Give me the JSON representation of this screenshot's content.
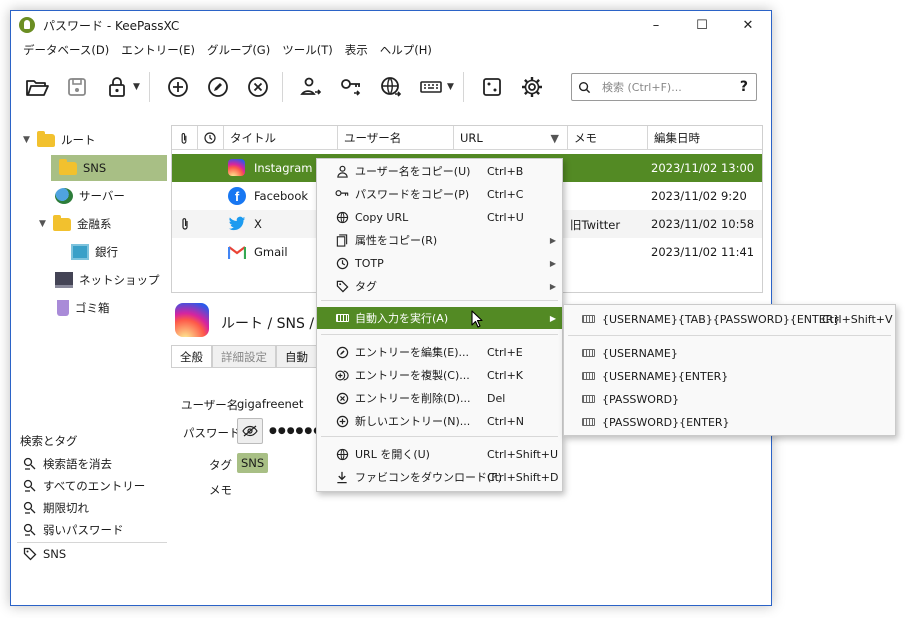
{
  "window": {
    "title": "パスワード - KeePassXC",
    "controls": [
      "–",
      "☐",
      "✕"
    ]
  },
  "menu": [
    "データベース(D)",
    "エントリー(E)",
    "グループ(G)",
    "ツール(T)",
    "表示",
    "ヘルプ(H)"
  ],
  "search": {
    "placeholder": "検索 (Ctrl+F)...",
    "help": "?"
  },
  "groups": [
    {
      "label": "ルート",
      "icon": "folder-icon"
    },
    {
      "label": "SNS",
      "icon": "folder-icon",
      "selected": true
    },
    {
      "label": "サーバー",
      "icon": "globe-icon"
    },
    {
      "label": "金融系",
      "icon": "folder-icon"
    },
    {
      "label": "銀行",
      "icon": "bank-icon"
    },
    {
      "label": "ネットショップ",
      "icon": "monitor-icon"
    },
    {
      "label": "ゴミ箱",
      "icon": "trash-icon"
    }
  ],
  "tags": {
    "header": "検索とタグ",
    "items": [
      "検索語を消去",
      "すべてのエントリー",
      "期限切れ",
      "弱いパスワード"
    ],
    "user_tags": [
      "SNS"
    ]
  },
  "table": {
    "columns": [
      "タイトル",
      "ユーザー名",
      "URL",
      "メモ",
      "編集日時"
    ],
    "rows": [
      {
        "title": "Instagram",
        "note": "",
        "modified": "2023/11/02 13:00",
        "icon": "instagram-icon",
        "selected": true
      },
      {
        "title": "Facebook",
        "note": "",
        "modified": "2023/11/02 9:20",
        "icon": "facebook-icon"
      },
      {
        "title": "X",
        "note": "旧Twitter",
        "modified": "2023/11/02 10:58",
        "icon": "twitter-icon",
        "attachment": true
      },
      {
        "title": "Gmail",
        "note": "",
        "modified": "2023/11/02 11:41",
        "icon": "gmail-icon"
      }
    ]
  },
  "details": {
    "breadcrumb": "ルート / SNS / In",
    "tabs": [
      "全般",
      "詳細設定",
      "自動"
    ],
    "username_label": "ユーザー名",
    "username_value": "gigafreenet",
    "password_label": "パスワード",
    "password_value": "●●●●●●",
    "tags_label": "タグ",
    "tags_value": "SNS",
    "notes_label": "メモ"
  },
  "context_menu": {
    "items": [
      {
        "label": "ユーザー名をコピー(U)",
        "shortcut": "Ctrl+B",
        "icon": "user-icon"
      },
      {
        "label": "パスワードをコピー(P)",
        "shortcut": "Ctrl+C",
        "icon": "key-icon"
      },
      {
        "label": "Copy URL",
        "shortcut": "Ctrl+U",
        "icon": "link-icon"
      },
      {
        "label": "属性をコピー(R)",
        "shortcut": "",
        "icon": "copy-icon",
        "submenu": true
      },
      {
        "label": "TOTP",
        "shortcut": "",
        "icon": "clock-icon",
        "submenu": true
      },
      {
        "label": "タグ",
        "shortcut": "",
        "icon": "tag-icon",
        "submenu": true
      },
      {
        "label": "自動入力を実行(A)",
        "shortcut": "",
        "icon": "keyboard-icon",
        "submenu": true,
        "highlighted": true
      },
      {
        "label": "エントリーを編集(E)...",
        "shortcut": "Ctrl+E",
        "icon": "edit-icon"
      },
      {
        "label": "エントリーを複製(C)...",
        "shortcut": "Ctrl+K",
        "icon": "clone-icon"
      },
      {
        "label": "エントリーを削除(D)...",
        "shortcut": "Del",
        "icon": "delete-icon"
      },
      {
        "label": "新しいエントリー(N)...",
        "shortcut": "Ctrl+N",
        "icon": "add-icon"
      },
      {
        "label": "URL を開く(U)",
        "shortcut": "Ctrl+Shift+U",
        "icon": "globe-icon"
      },
      {
        "label": "ファビコンをダウンロード(F)",
        "shortcut": "Ctrl+Shift+D",
        "icon": "download-icon"
      }
    ]
  },
  "autotype_submenu": {
    "items": [
      {
        "label": "{USERNAME}{TAB}{PASSWORD}{ENTER}",
        "shortcut": "Ctrl+Shift+V"
      },
      {
        "label": "{USERNAME}",
        "shortcut": ""
      },
      {
        "label": "{USERNAME}{ENTER}",
        "shortcut": ""
      },
      {
        "label": "{PASSWORD}",
        "shortcut": ""
      },
      {
        "label": "{PASSWORD}{ENTER}",
        "shortcut": ""
      }
    ]
  },
  "colors": {
    "accent": "#538a24",
    "selection_light": "#a8bf85"
  }
}
